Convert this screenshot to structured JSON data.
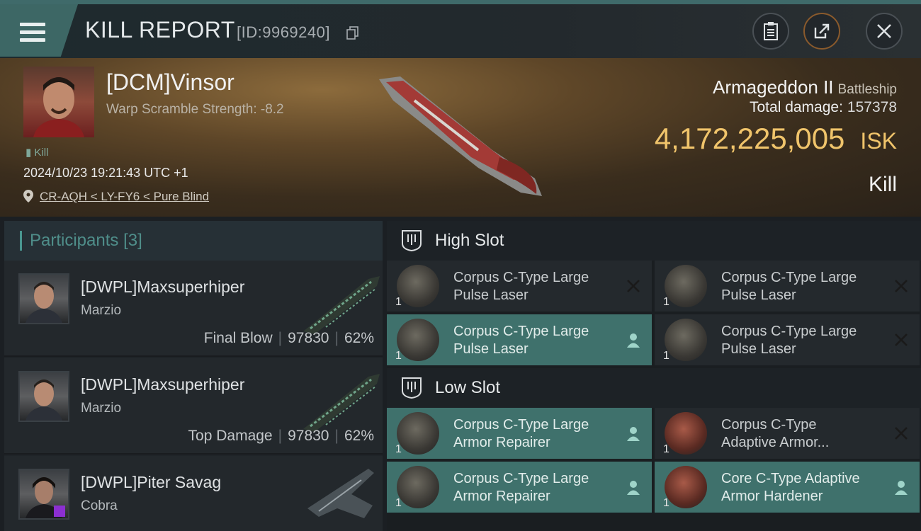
{
  "header": {
    "title": "KILL REPORT",
    "id_text": "[ID:9969240]",
    "buttons": [
      "clipboard-icon",
      "share-icon",
      "close-icon"
    ]
  },
  "victim": {
    "name": "[DCM]Vinsor",
    "subtitle": "Warp Scramble Strength: -8.2",
    "kill_tag": "Kill",
    "timestamp": "2024/10/23 19:21:43 UTC +1",
    "location": "CR-AQH < LY-FY6 < Pure Blind",
    "ship": "Armageddon II",
    "ship_class": "Battleship",
    "total_damage_label": "Total damage:",
    "total_damage": "157378",
    "isk_value": "4,172,225,005",
    "isk_unit": "ISK",
    "result": "Kill"
  },
  "participants": {
    "label": "Participants",
    "count": "[3]",
    "rows": [
      {
        "name": "[DWPL]Maxsuperhiper",
        "ship": "Marzio",
        "role": "Final Blow",
        "damage": "97830",
        "percent": "62%"
      },
      {
        "name": "[DWPL]Maxsuperhiper",
        "ship": "Marzio",
        "role": "Top Damage",
        "damage": "97830",
        "percent": "62%"
      },
      {
        "name": "[DWPL]Piter Savag",
        "ship": "Cobra",
        "role": "",
        "damage": "",
        "percent": ""
      }
    ]
  },
  "slots": {
    "high": {
      "title": "High Slot",
      "modules": [
        {
          "line1": "Corpus C-Type Large",
          "line2": "Pulse Laser",
          "qty": "1",
          "status": "destroyed"
        },
        {
          "line1": "Corpus C-Type Large",
          "line2": "Pulse Laser",
          "qty": "1",
          "status": "destroyed"
        },
        {
          "line1": "Corpus C-Type Large",
          "line2": "Pulse Laser",
          "qty": "1",
          "status": "dropped"
        },
        {
          "line1": "Corpus C-Type Large",
          "line2": "Pulse Laser",
          "qty": "1",
          "status": "destroyed"
        }
      ]
    },
    "low": {
      "title": "Low Slot",
      "modules": [
        {
          "line1": "Corpus C-Type Large",
          "line2": "Armor Repairer",
          "qty": "1",
          "status": "dropped"
        },
        {
          "line1": "Corpus C-Type",
          "line2": "Adaptive Armor...",
          "qty": "1",
          "status": "destroyed"
        },
        {
          "line1": "Corpus C-Type Large",
          "line2": "Armor Repairer",
          "qty": "1",
          "status": "dropped"
        },
        {
          "line1": "Core C-Type Adaptive",
          "line2": "Armor Hardener",
          "qty": "1",
          "status": "dropped"
        }
      ]
    }
  },
  "colors": {
    "accent_teal": "#3f716c",
    "isk_gold": "#f0c46b",
    "participants_title": "#4f8e8a"
  }
}
